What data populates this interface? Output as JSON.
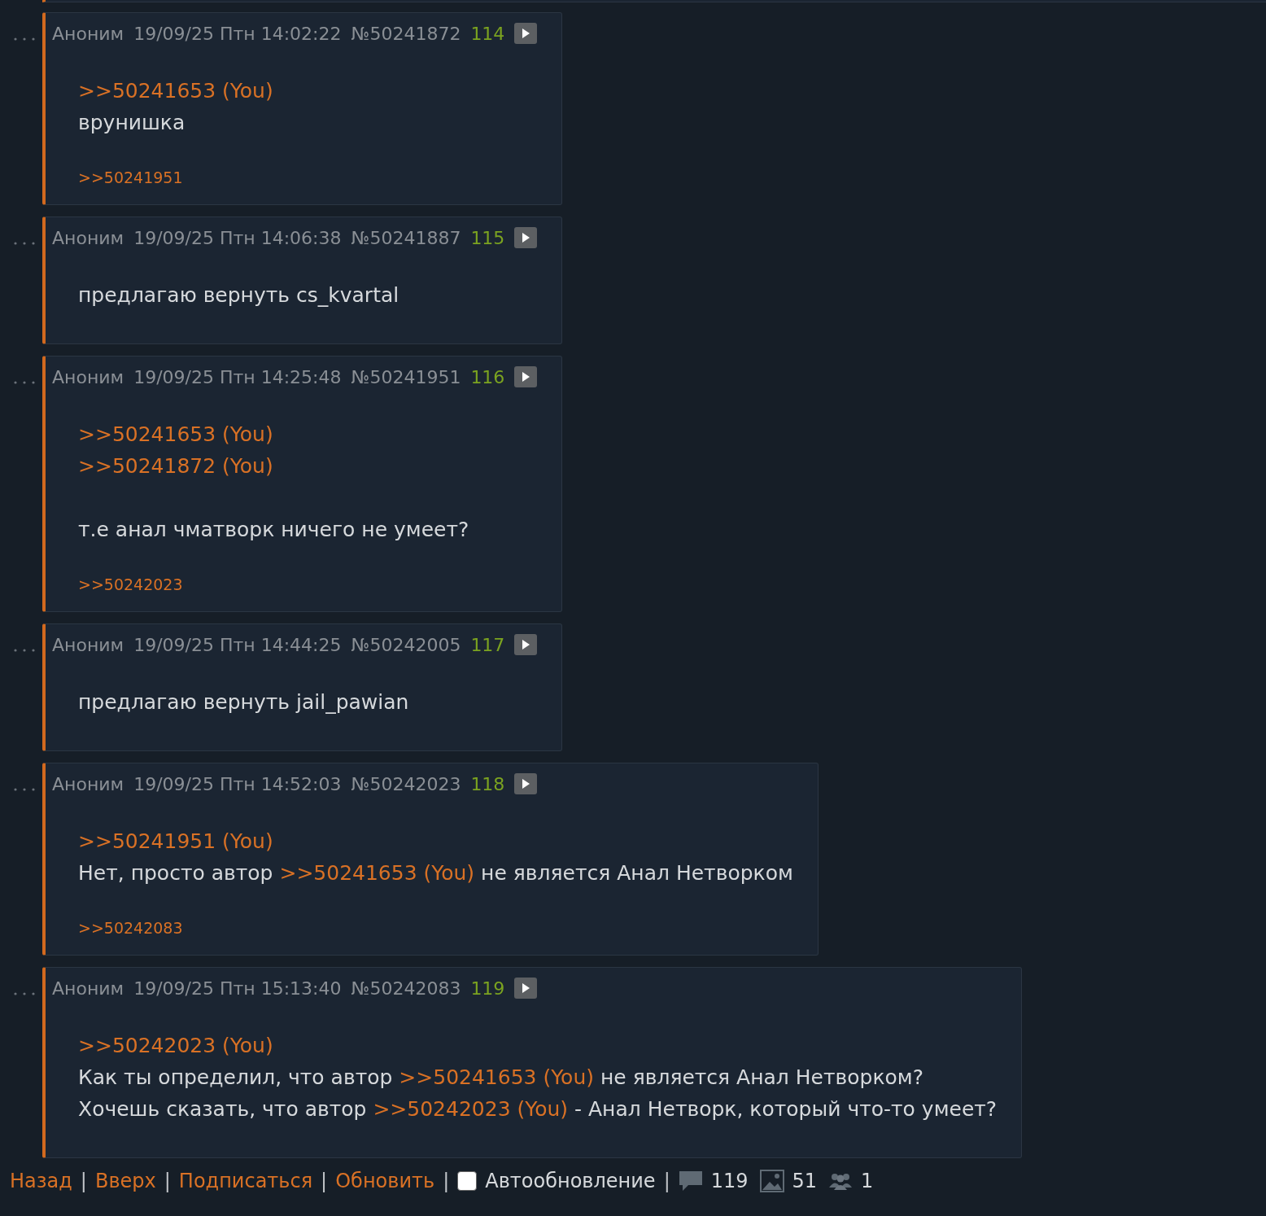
{
  "posts": [
    {
      "name": "Аноним",
      "date": "19/09/25 Птн 14:02:22",
      "number": "№50241872",
      "index": "114",
      "blocks": [
        [
          [
            {
              "kind": "link",
              "text": ">>50241653 (You)"
            }
          ],
          [
            {
              "kind": "text",
              "text": "врунишка"
            }
          ]
        ]
      ],
      "replies": [
        ">>50241951"
      ]
    },
    {
      "name": "Аноним",
      "date": "19/09/25 Птн 14:06:38",
      "number": "№50241887",
      "index": "115",
      "blocks": [
        [
          [
            {
              "kind": "text",
              "text": "предлагаю вернуть cs_kvartal"
            }
          ]
        ]
      ]
    },
    {
      "name": "Аноним",
      "date": "19/09/25 Птн 14:25:48",
      "number": "№50241951",
      "index": "116",
      "blocks": [
        [
          [
            {
              "kind": "link",
              "text": ">>50241653 (You)"
            }
          ],
          [
            {
              "kind": "link",
              "text": ">>50241872 (You)"
            }
          ]
        ],
        [
          [
            {
              "kind": "text",
              "text": "т.е анал чматворк ничего не умеет?"
            }
          ]
        ]
      ],
      "replies": [
        ">>50242023"
      ]
    },
    {
      "name": "Аноним",
      "date": "19/09/25 Птн 14:44:25",
      "number": "№50242005",
      "index": "117",
      "blocks": [
        [
          [
            {
              "kind": "text",
              "text": "предлагаю вернуть jail_pawian"
            }
          ]
        ]
      ]
    },
    {
      "name": "Аноним",
      "date": "19/09/25 Птн 14:52:03",
      "number": "№50242023",
      "index": "118",
      "blocks": [
        [
          [
            {
              "kind": "link",
              "text": ">>50241951 (You)"
            }
          ],
          [
            {
              "kind": "text",
              "text": "Нет, просто автор "
            },
            {
              "kind": "link",
              "text": ">>50241653 (You)"
            },
            {
              "kind": "text",
              "text": " не является Анал Нетворком"
            }
          ]
        ]
      ],
      "replies": [
        ">>50242083"
      ]
    },
    {
      "name": "Аноним",
      "date": "19/09/25 Птн 15:13:40",
      "number": "№50242083",
      "index": "119",
      "blocks": [
        [
          [
            {
              "kind": "link",
              "text": ">>50242023 (You)"
            }
          ],
          [
            {
              "kind": "text",
              "text": "Как ты определил, что автор "
            },
            {
              "kind": "link",
              "text": ">>50241653 (You)"
            },
            {
              "kind": "text",
              "text": " не является Анал Нетворком?"
            }
          ],
          [
            {
              "kind": "text",
              "text": "Хочешь сказать, что автор "
            },
            {
              "kind": "link",
              "text": ">>50242023 (You)"
            },
            {
              "kind": "text",
              "text": " - Анал Нетворк, который что-то умеет?"
            }
          ]
        ]
      ]
    }
  ],
  "footer": {
    "links": [
      "Назад",
      "Вверх",
      "Подписаться",
      "Обновить"
    ],
    "separator": "|",
    "autoupdate": {
      "label": "Автообновление",
      "checked": false
    },
    "stats": [
      {
        "kind": "posts",
        "value": "119"
      },
      {
        "kind": "images",
        "value": "51"
      },
      {
        "kind": "posters",
        "value": "1"
      }
    ]
  }
}
